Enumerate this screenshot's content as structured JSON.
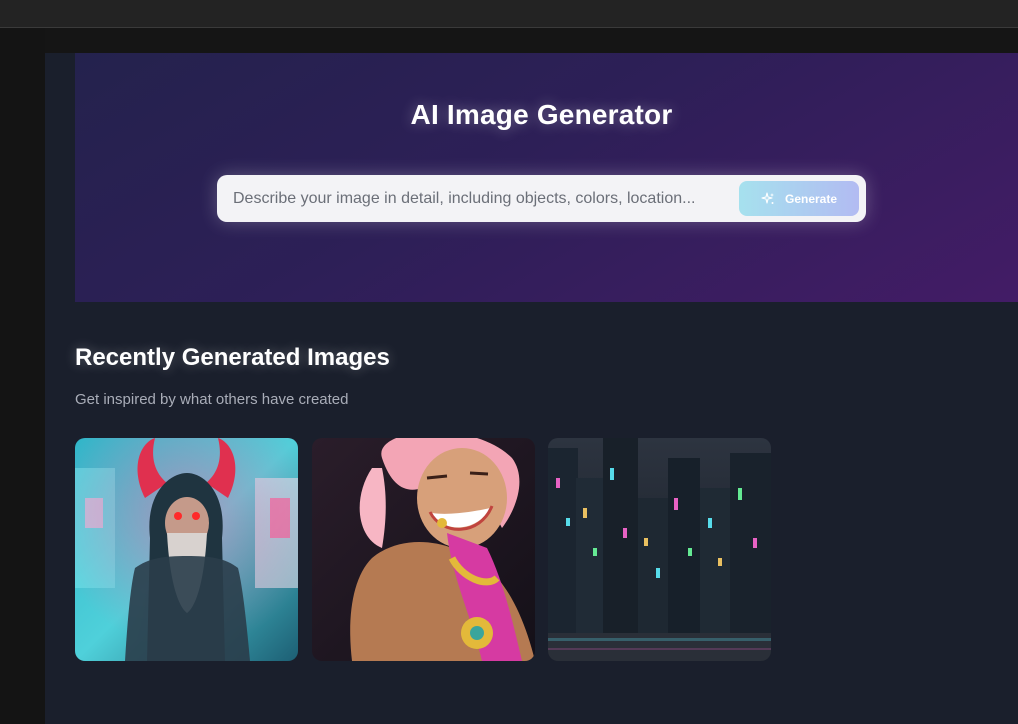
{
  "hero": {
    "title": "AI Image Generator"
  },
  "search": {
    "placeholder": "Describe your image in detail, including objects, colors, location...",
    "value": "",
    "button_label": "Generate",
    "button_icon": "sparkles-icon"
  },
  "gallery": {
    "title": "Recently Generated Images",
    "subtitle": "Get inspired by what others have created",
    "images": [
      {
        "subject": "horned-hooded-old-man-city"
      },
      {
        "subject": "smiling-pink-haired-woman"
      },
      {
        "subject": "neon-cyberpunk-cityscape"
      }
    ]
  },
  "colors": {
    "hero_gradient_start": "#24224d",
    "hero_gradient_end": "#431c66",
    "page_background": "#1a1f2c",
    "button_gradient_start": "#a6e1ee",
    "button_gradient_end": "#b2bbf2"
  }
}
